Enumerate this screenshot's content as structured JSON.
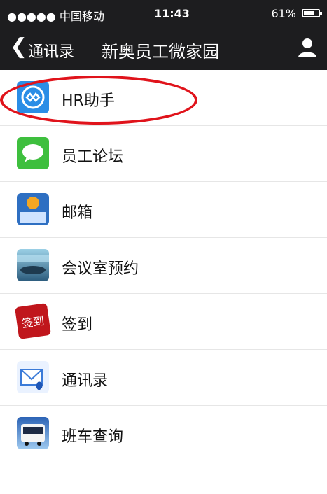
{
  "status_bar": {
    "carrier": "●●●●● 中国移动",
    "time": "11:43",
    "battery": "61%"
  },
  "nav": {
    "back_label": "通讯录",
    "title": "新奥员工微家园"
  },
  "list": {
    "items": [
      {
        "label": "HR助手",
        "icon": "hr-assistant-icon"
      },
      {
        "label": "员工论坛",
        "icon": "forum-icon"
      },
      {
        "label": "邮箱",
        "icon": "mail-icon"
      },
      {
        "label": "会议室预约",
        "icon": "meeting-room-icon"
      },
      {
        "label": "签到",
        "icon": "checkin-icon"
      },
      {
        "label": "通讯录",
        "icon": "contacts-icon"
      },
      {
        "label": "班车查询",
        "icon": "bus-icon"
      }
    ]
  },
  "highlight": {
    "color": "#e0131b"
  },
  "checkin_stamp": "签到"
}
